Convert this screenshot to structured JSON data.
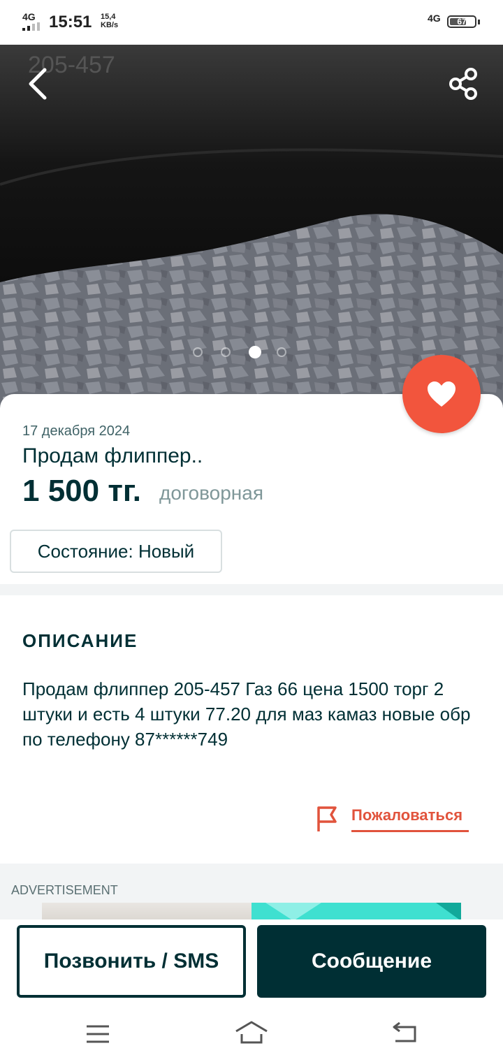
{
  "status_bar": {
    "network_left": "4G",
    "time": "15:51",
    "speed_value": "15,4",
    "speed_unit": "KB/s",
    "network_right": "4G",
    "battery": "67",
    "battery_level": 0.67
  },
  "gallery": {
    "page_count": 4,
    "active_index": 2
  },
  "listing": {
    "date": "17 декабря 2024",
    "title": "Продам флиппер..",
    "price": "1 500 тг.",
    "negotiable": "договорная",
    "condition": "Состояние: Новый"
  },
  "description": {
    "heading": "ОПИСАНИЕ",
    "text": "Продам флиппер 205-457 Газ 66 цена 1500 торг 2 штуки и есть 4 штуки 77.20 для маз камаз новые обр по телефону 87******749"
  },
  "report": {
    "label": "Пожаловаться"
  },
  "ad": {
    "label": "ADVERTISEMENT"
  },
  "actions": {
    "call_label": "Позвонить / SMS",
    "message_label": "Сообщение"
  },
  "icons": {
    "back": "chevron-left-icon",
    "share": "share-icon",
    "favorite": "heart-icon",
    "report": "flag-icon",
    "nav_menu": "menu-icon",
    "nav_home": "home-icon",
    "nav_back": "back-icon"
  },
  "colors": {
    "brand_dark": "#002f34",
    "accent_red": "#f2553d",
    "report_red": "#e1533c",
    "muted_text": "#7f9799"
  }
}
